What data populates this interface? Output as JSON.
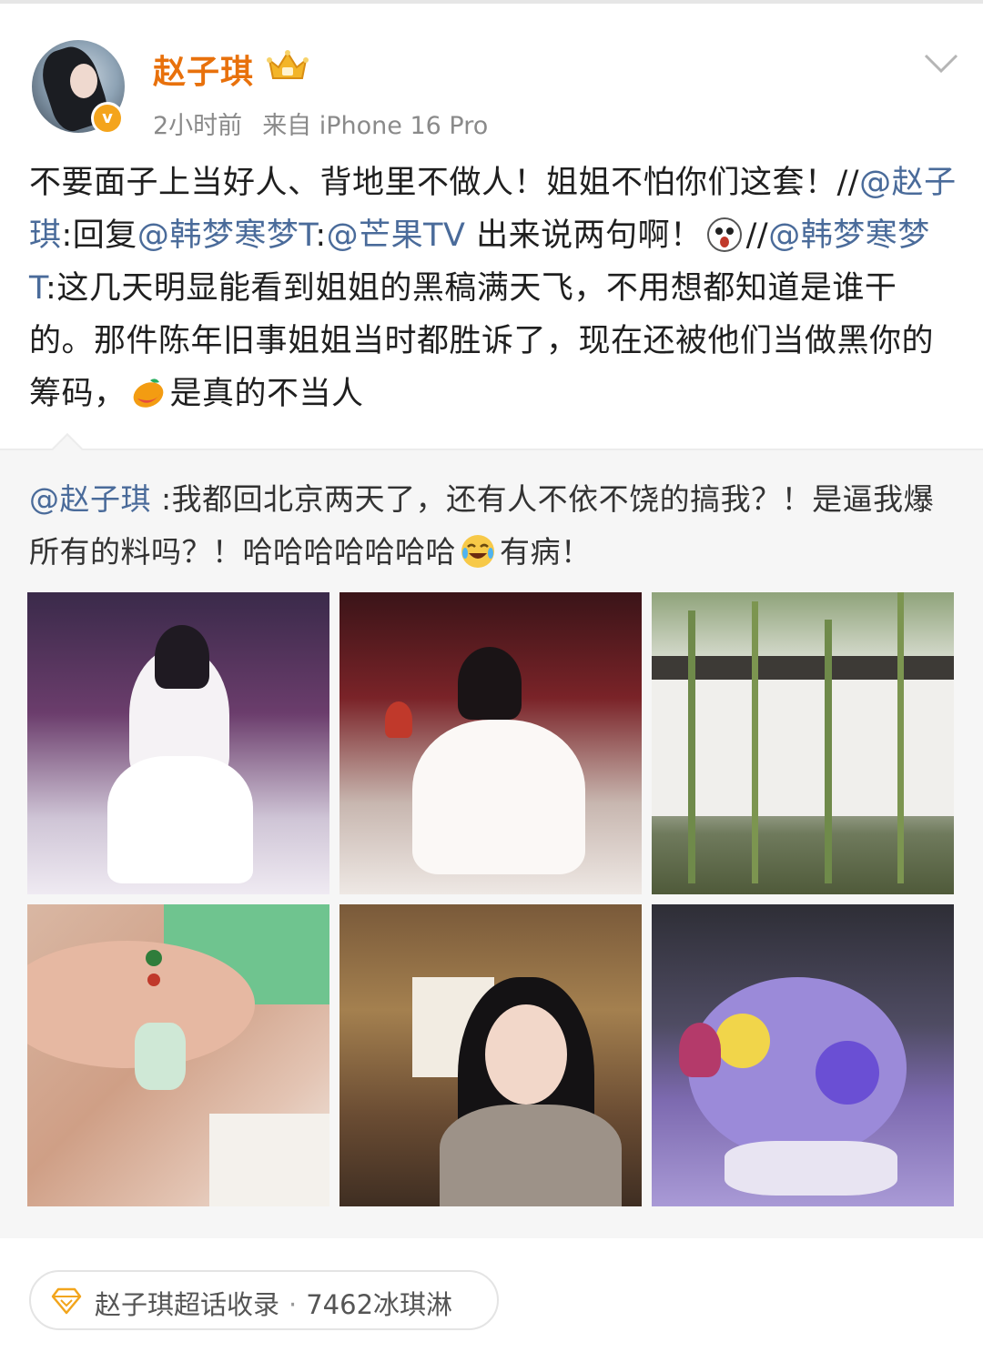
{
  "post": {
    "username": "赵子琪",
    "time": "2小时前",
    "source": "来自 iPhone 16 Pro",
    "text_1": "不要面子上当好人、背地里不做人！姐姐不怕你们这套！//",
    "mention_1": "@赵子琪",
    "text_2": ":回复",
    "mention_2": "@韩梦寒梦T",
    "text_3": ":",
    "mention_3": "@芒果TV",
    "text_4": " 出来说两句啊！",
    "text_5": "//",
    "mention_4": "@韩梦寒梦T",
    "text_6": ":这几天明显能看到姐姐的黑稿满天飞，不用想都知道是谁干的。那件陈年旧事姐姐当时都胜诉了，现在还被他们当做黑你的筹码，",
    "text_7": "是真的不当人"
  },
  "repost": {
    "mention": "@赵子琪",
    "text_1": " :我都回北京两天了，还有人不依不饶的搞我？！是逼我爆所有的料吗？！哈哈哈哈哈哈哈",
    "text_2": "有病！",
    "photos": [
      "stage-photo-1",
      "stage-photo-2",
      "garden-photo",
      "jade-pendant-photo",
      "portrait-photo",
      "flower-bouquet-photo"
    ]
  },
  "footer": {
    "topic": "赵子琪超话收录",
    "separator": "·",
    "count": "7462冰琪淋"
  },
  "icons": {
    "verified": "v",
    "crown": "crown-icon",
    "chevron": "chevron-down-icon",
    "diamond": "diamond-icon"
  },
  "colors": {
    "username": "#e8710c",
    "mention": "#4a6b9a",
    "meta": "#8a8a8a"
  }
}
